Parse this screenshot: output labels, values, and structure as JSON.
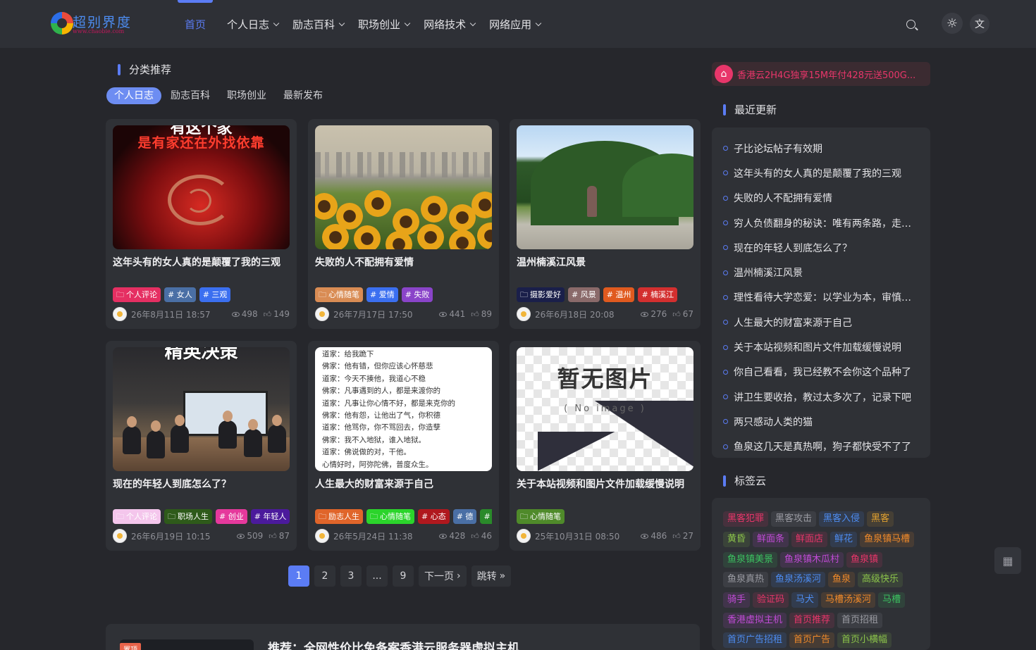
{
  "header": {
    "logo_text": "超别界度",
    "logo_sub": "www.chaobie.com",
    "nav": [
      {
        "label": "首页"
      },
      {
        "label": "个人日志"
      },
      {
        "label": "励志百科"
      },
      {
        "label": "职场创业"
      },
      {
        "label": "网络技术"
      },
      {
        "label": "网络应用"
      }
    ],
    "icons": {
      "search": "search-icon",
      "theme": "sun-icon",
      "lang": "translate-icon"
    },
    "lang_glyph": "文"
  },
  "category": {
    "title": "分类推荐",
    "tabs": [
      "个人日志",
      "励志百科",
      "职场创业",
      "最新发布"
    ]
  },
  "posts": [
    {
      "title": "这年头有的女人真的是颠覆了我的三观",
      "thumb_caption": "是有家还在外找依靠",
      "thumb_caption_top": "有这个家",
      "tags": [
        {
          "label": "个人评论",
          "color": "#e52f62",
          "icon": "folder-icon"
        },
        {
          "label": "# 女人",
          "color": "#4a6fa5"
        },
        {
          "label": "# 三观",
          "color": "#3b6ff0"
        }
      ],
      "date": "26年8月11日 18:57",
      "views": "498",
      "likes": "149"
    },
    {
      "title": "失败的人不配拥有爱情",
      "tags": [
        {
          "label": "心情随笔",
          "color": "#d98c54",
          "icon": "folder-icon"
        },
        {
          "label": "# 爱情",
          "color": "#3b6ff0"
        },
        {
          "label": "# 失败",
          "color": "#8a44c9"
        }
      ],
      "date": "26年7月17日 17:50",
      "views": "441",
      "likes": "89"
    },
    {
      "title": "温州楠溪江风景",
      "tags": [
        {
          "label": "摄影爱好",
          "color": "#1a1f4a",
          "icon": "folder-icon"
        },
        {
          "label": "# 风景",
          "color": "#8a6a6a"
        },
        {
          "label": "# 温州",
          "color": "#e05a1f"
        },
        {
          "label": "# 楠溪江",
          "color": "#d32f2f"
        }
      ],
      "date": "26年6月18日 20:08",
      "views": "276",
      "likes": "67"
    },
    {
      "title": "现在的年轻人到底怎么了？",
      "thumb_caption_top": "精英决策",
      "tags": [
        {
          "label": "个人评论",
          "color": "#f4c6ec",
          "icon": "folder-icon"
        },
        {
          "label": "职场人生",
          "color": "#2e5a1a",
          "icon": "folder-icon"
        },
        {
          "label": "# 创业",
          "color": "#e5399c"
        },
        {
          "label": "# 年轻人",
          "color": "#4b1a9c"
        }
      ],
      "date": "26年6月19日 10:15",
      "views": "509",
      "likes": "87"
    },
    {
      "title": "人生最大的财富来源于自己",
      "thumb_lines": [
        "道家：给我跪下",
        "佛家：他有错，但你应该心怀慈悲",
        "道家：今天不揍他，我道心不稳",
        "佛家：凡事遇到的人，都是来渡你的",
        "道家：凡事让你心情不好，都是来克你的",
        "佛家：他有怨，让他出了气，你积德",
        "道家：他骂你，你不骂回去，你造孽",
        "佛家：我不入地狱，谁入地狱。",
        "道家：佛说做的对，干他。",
        "心情好时，阿弥陀佛，普度众生。"
      ],
      "tags": [
        {
          "label": "励志人生",
          "color": "#e0652a",
          "icon": "folder-icon"
        },
        {
          "label": "心情随笔",
          "color": "#2bd42b",
          "icon": "folder-icon"
        },
        {
          "label": "# 心态",
          "color": "#b0181e"
        },
        {
          "label": "# 德",
          "color": "#4a6fa5"
        },
        {
          "label": "# 善",
          "color": "#2a8a2a"
        }
      ],
      "date": "26年5月24日 11:38",
      "views": "428",
      "likes": "46"
    },
    {
      "title": "关于本站视频和图片文件加载缓慢说明",
      "thumb_big": "暂无图片",
      "thumb_small": "( No image )",
      "tags": [
        {
          "label": "心情随笔",
          "color": "#4f8a2a",
          "icon": "folder-icon"
        }
      ],
      "date": "25年10月31日 08:50",
      "views": "486",
      "likes": "27"
    }
  ],
  "pagination": {
    "pages": [
      "1",
      "2",
      "3",
      "...",
      "9"
    ],
    "next": "下一页",
    "jump": "跳转"
  },
  "promo": {
    "badge": "置顶",
    "title": "推荐：全网性价比免备案香港云服务器虚拟主机"
  },
  "sidebar": {
    "ad_text": "香港云2H4G独享15M年付428元送500G...",
    "recent_title": "最近更新",
    "recent": [
      "子比论坛帖子有效期",
      "这年头有的女人真的是颠覆了我的三观",
      "失败的人不配拥有爱情",
      "穷人负债翻身的秘诀：唯有两条路，走对了就能翻身",
      "现在的年轻人到底怎么了？",
      "温州楠溪江风景",
      "理性看待大学恋爱：以学业为本，审慎对待情感",
      "人生最大的财富来源于自己",
      "关于本站视频和图片文件加载缓慢说明",
      "你自己看看，我已经教不会你这个品种了",
      "讲卫生要收拾，教过太多次了，记录下吧",
      "两只感动人类的猫",
      "鱼泉这几天是真热啊，狗子都快受不了了"
    ],
    "tags_title": "标签云",
    "tag_rows": [
      [
        {
          "t": "黑客犯罪",
          "c": "#e8366a"
        },
        {
          "t": "黑客攻击",
          "c": "#9a9ba2"
        },
        {
          "t": "黑客入侵",
          "c": "#4d8cf0"
        },
        {
          "t": "黑客",
          "c": "#e0a030"
        }
      ],
      [
        {
          "t": "黄昏",
          "c": "#8bc34a"
        },
        {
          "t": "鲜面条",
          "c": "#c14bd6"
        },
        {
          "t": "鲜面店",
          "c": "#e8366a"
        },
        {
          "t": "鲜花",
          "c": "#4d8cf0"
        },
        {
          "t": "鱼泉镇马槽",
          "c": "#f08a2a"
        }
      ],
      [
        {
          "t": "鱼泉镇美景",
          "c": "#3cc060"
        },
        {
          "t": "鱼泉镇木瓜村",
          "c": "#c14bd6"
        },
        {
          "t": "鱼泉镇",
          "c": "#e8366a"
        }
      ],
      [
        {
          "t": "鱼泉真热",
          "c": "#9a9ba2"
        },
        {
          "t": "鱼泉汤溪河",
          "c": "#4d8cf0"
        },
        {
          "t": "鱼泉",
          "c": "#f08a2a"
        },
        {
          "t": "高级快乐",
          "c": "#8bc34a"
        }
      ],
      [
        {
          "t": "骑手",
          "c": "#c14bd6"
        },
        {
          "t": "验证码",
          "c": "#e8366a"
        },
        {
          "t": "马犬",
          "c": "#4d8cf0"
        },
        {
          "t": "马槽汤溪河",
          "c": "#f08a2a"
        },
        {
          "t": "马槽",
          "c": "#3cc060"
        }
      ],
      [
        {
          "t": "香港虚拟主机",
          "c": "#c14bd6"
        },
        {
          "t": "首页推荐",
          "c": "#e8366a"
        },
        {
          "t": "首页招租",
          "c": "#9a9ba2"
        }
      ],
      [
        {
          "t": "首页广告招租",
          "c": "#4d8cf0"
        },
        {
          "t": "首页广告",
          "c": "#f08a2a"
        },
        {
          "t": "首页小横幅",
          "c": "#8bc34a"
        }
      ]
    ]
  }
}
